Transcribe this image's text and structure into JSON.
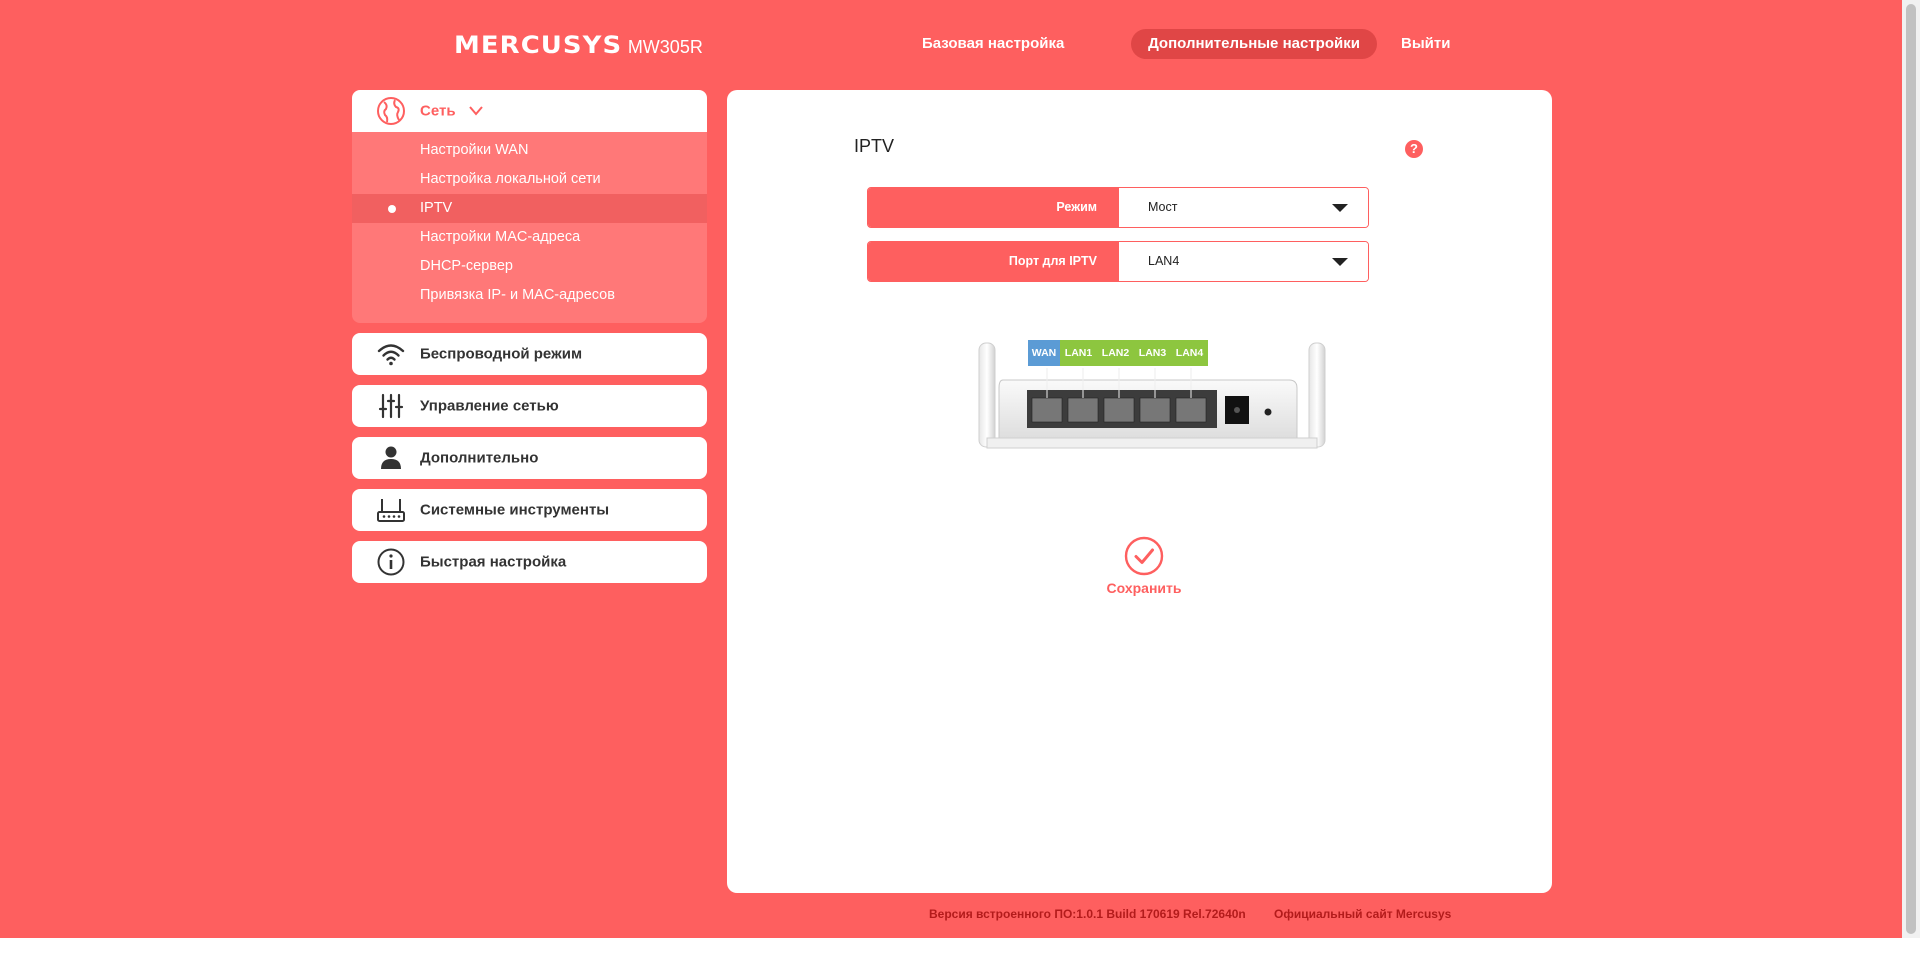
{
  "header": {
    "brand": "MERCUSYS",
    "model": "MW305R",
    "nav": {
      "basic": "Базовая настройка",
      "advanced": "Дополнительные настройки",
      "logout": "Выйти"
    }
  },
  "sidebar": {
    "network": {
      "label": "Сеть",
      "items": [
        {
          "label": "Настройки WAN"
        },
        {
          "label": "Настройка локальной сети"
        },
        {
          "label": "IPTV",
          "active": true
        },
        {
          "label": "Настройки MAC-адреса"
        },
        {
          "label": "DHCP-сервер"
        },
        {
          "label": "Привязка IP- и MAC-адресов"
        }
      ]
    },
    "groups": {
      "wireless": "Беспроводной режим",
      "net_control": "Управление сетью",
      "advanced": "Дополнительно",
      "system_tools": "Системные инструменты",
      "quick_setup": "Быстрая настройка"
    }
  },
  "main": {
    "title": "IPTV",
    "help": "?",
    "mode": {
      "label": "Режим",
      "value": "Мост"
    },
    "port": {
      "label": "Порт для IPTV",
      "value": "LAN4"
    },
    "router_ports": {
      "wan": "WAN",
      "lan1": "LAN1",
      "lan2": "LAN2",
      "lan3": "LAN3",
      "lan4": "LAN4"
    },
    "save": "Сохранить"
  },
  "footer": {
    "version": "Версия встроенного ПО:1.0.1 Build 170619 Rel.72640n",
    "site": "Официальный сайт Mercusys"
  },
  "colors": {
    "accent": "#fe5f5f",
    "wan_port": "#5b9bd5",
    "lan_port": "#8dc63f"
  }
}
